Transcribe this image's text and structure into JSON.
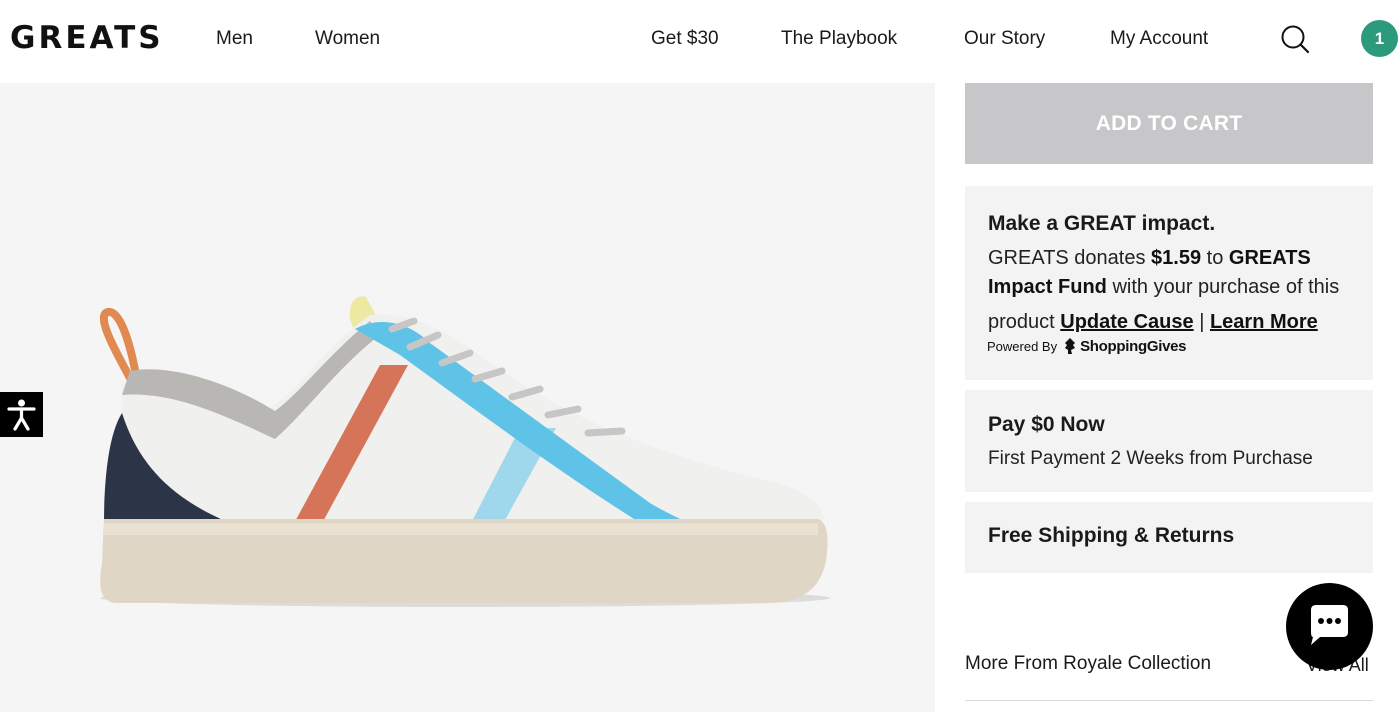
{
  "header": {
    "logo": "GREATS",
    "nav_left": [
      {
        "label": "Men"
      },
      {
        "label": "Women"
      }
    ],
    "nav_right": [
      {
        "label": "Get $30"
      },
      {
        "label": "The Playbook"
      },
      {
        "label": "Our Story"
      },
      {
        "label": "My Account"
      }
    ],
    "search_icon": "search-icon",
    "cart_count": "1",
    "cart_color": "#2b9a7d"
  },
  "product_image": {
    "icon": "sneaker-image",
    "accessibility_icon": "accessibility-icon"
  },
  "cart": {
    "button_label": "ADD TO CART",
    "button_color": "#c7c7c9"
  },
  "impact": {
    "title": "Make a GREAT impact.",
    "text_1": "GREATS donates ",
    "amount": "$1.59",
    "text_2": " to ",
    "fund": "GREATS Impact Fund",
    "text_3": " with your purchase of this product ",
    "update_cause": "Update Cause",
    "separator": " | ",
    "learn_more": "Learn More",
    "powered_by": "Powered By",
    "partner": "ShoppingGives"
  },
  "pay": {
    "title": "Pay $0 Now",
    "subtitle": "First Payment 2 Weeks from Purchase"
  },
  "shipping": {
    "title": "Free Shipping & Returns"
  },
  "more": {
    "title": "More From Royale Collection",
    "view_all": "View All"
  },
  "chat": {
    "icon": "chat-icon"
  }
}
